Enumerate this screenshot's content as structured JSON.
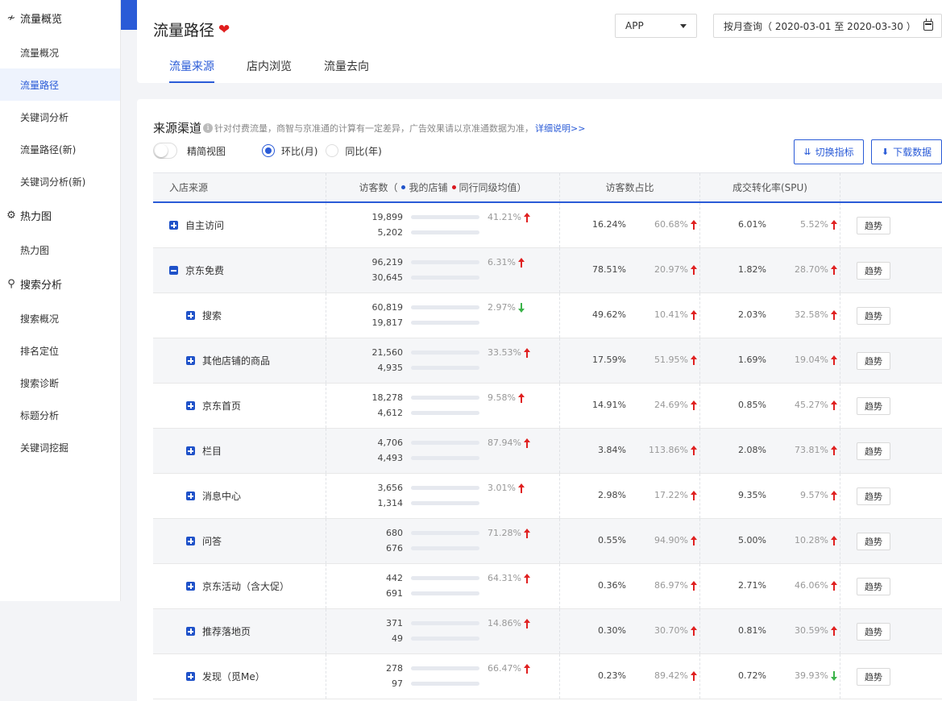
{
  "sidebar": {
    "groups": [
      {
        "icon": "pulse-icon",
        "label": "流量概览",
        "items": [
          "流量概况",
          "流量路径",
          "关键词分析",
          "流量路径(新)",
          "关键词分析(新)"
        ]
      },
      {
        "icon": "heatmap-icon",
        "label": "热力图",
        "items": [
          "热力图"
        ]
      },
      {
        "icon": "search-analysis-icon",
        "label": "搜索分析",
        "items": [
          "搜索概况",
          "排名定位",
          "搜索诊断",
          "标题分析",
          "关键词挖掘"
        ]
      }
    ],
    "active_item": "流量路径"
  },
  "header": {
    "title": "流量路径",
    "device_select": "APP",
    "date_range": "按月查询（ 2020-03-01 至 2020-03-30 ）",
    "tabs": [
      "流量来源",
      "店内浏览",
      "流量去向"
    ]
  },
  "section": {
    "title": "来源渠道",
    "note": "针对付费流量，商智与京准通的计算有一定差异，广告效果请以京准通数据为准，",
    "link": "详细说明>>",
    "toggle_label": "精简视图",
    "radio_month": "环比(月)",
    "radio_year": "同比(年)",
    "switch_button": "切换指标",
    "download_button": "下载数据"
  },
  "colors": {
    "accent": "#2a5bd7",
    "my_shop": "#1f52c9",
    "peer": "#d9171f",
    "up": "#e02020",
    "down": "#3bb34a"
  },
  "table": {
    "headers": {
      "source": "入店来源",
      "visitors_prefix": "访客数（",
      "legend_my": "我的店铺",
      "legend_peer": "同行同级均值",
      "visitors_suffix": "）",
      "share": "访客数占比",
      "conversion": "成交转化率(SPU)"
    },
    "trend_label": "趋势",
    "rows": [
      {
        "name": "自主访问",
        "level": 0,
        "expand": "plus",
        "my": "19,899",
        "peer": "5,202",
        "my_ratio": 0.25,
        "peer_ratio": 0.1,
        "chg": "41.21%",
        "chg_dir": "up",
        "share": "16.24%",
        "share_chg": "60.68%",
        "share_dir": "up",
        "conv": "6.01%",
        "conv_chg": "5.52%",
        "conv_dir": "up"
      },
      {
        "name": "京东免费",
        "level": 0,
        "expand": "minus",
        "my": "96,219",
        "peer": "30,645",
        "my_ratio": 1.0,
        "peer_ratio": 0.35,
        "chg": "6.31%",
        "chg_dir": "up",
        "share": "78.51%",
        "share_chg": "20.97%",
        "share_dir": "up",
        "conv": "1.82%",
        "conv_chg": "28.70%",
        "conv_dir": "up"
      },
      {
        "name": "搜索",
        "level": 1,
        "expand": "plus",
        "my": "60,819",
        "peer": "19,817",
        "my_ratio": 0.65,
        "peer_ratio": 0.25,
        "chg": "2.97%",
        "chg_dir": "down",
        "share": "49.62%",
        "share_chg": "10.41%",
        "share_dir": "up",
        "conv": "2.03%",
        "conv_chg": "32.58%",
        "conv_dir": "up"
      },
      {
        "name": "其他店铺的商品",
        "level": 1,
        "expand": "plus",
        "my": "21,560",
        "peer": "4,935",
        "my_ratio": 0.26,
        "peer_ratio": 0.09,
        "chg": "33.53%",
        "chg_dir": "up",
        "share": "17.59%",
        "share_chg": "51.95%",
        "share_dir": "up",
        "conv": "1.69%",
        "conv_chg": "19.04%",
        "conv_dir": "up"
      },
      {
        "name": "京东首页",
        "level": 1,
        "expand": "plus",
        "my": "18,278",
        "peer": "4,612",
        "my_ratio": 0.24,
        "peer_ratio": 0.09,
        "chg": "9.58%",
        "chg_dir": "up",
        "share": "14.91%",
        "share_chg": "24.69%",
        "share_dir": "up",
        "conv": "0.85%",
        "conv_chg": "45.27%",
        "conv_dir": "up"
      },
      {
        "name": "栏目",
        "level": 1,
        "expand": "plus",
        "my": "4,706",
        "peer": "4,493",
        "my_ratio": 0.09,
        "peer_ratio": 0.09,
        "chg": "87.94%",
        "chg_dir": "up",
        "share": "3.84%",
        "share_chg": "113.86%",
        "share_dir": "up",
        "conv": "2.08%",
        "conv_chg": "73.81%",
        "conv_dir": "up"
      },
      {
        "name": "消息中心",
        "level": 1,
        "expand": "plus",
        "my": "3,656",
        "peer": "1,314",
        "my_ratio": 0.07,
        "peer_ratio": 0.05,
        "chg": "3.01%",
        "chg_dir": "up",
        "share": "2.98%",
        "share_chg": "17.22%",
        "share_dir": "up",
        "conv": "9.35%",
        "conv_chg": "9.57%",
        "conv_dir": "up"
      },
      {
        "name": "问答",
        "level": 1,
        "expand": "plus",
        "my": "680",
        "peer": "676",
        "my_ratio": 0.05,
        "peer_ratio": 0.05,
        "chg": "71.28%",
        "chg_dir": "up",
        "share": "0.55%",
        "share_chg": "94.90%",
        "share_dir": "up",
        "conv": "5.00%",
        "conv_chg": "10.28%",
        "conv_dir": "up"
      },
      {
        "name": "京东活动（含大促）",
        "level": 1,
        "expand": "plus",
        "my": "442",
        "peer": "691",
        "my_ratio": 0.02,
        "peer_ratio": 0.04,
        "chg": "64.31%",
        "chg_dir": "up",
        "share": "0.36%",
        "share_chg": "86.97%",
        "share_dir": "up",
        "conv": "2.71%",
        "conv_chg": "46.06%",
        "conv_dir": "up"
      },
      {
        "name": "推荐落地页",
        "level": 1,
        "expand": "plus",
        "my": "371",
        "peer": "49",
        "my_ratio": 0.02,
        "peer_ratio": 0.02,
        "chg": "14.86%",
        "chg_dir": "up",
        "share": "0.30%",
        "share_chg": "30.70%",
        "share_dir": "up",
        "conv": "0.81%",
        "conv_chg": "30.59%",
        "conv_dir": "up"
      },
      {
        "name": "发现（觅Me）",
        "level": 1,
        "expand": "plus",
        "my": "278",
        "peer": "97",
        "my_ratio": 0.02,
        "peer_ratio": 0.02,
        "chg": "66.47%",
        "chg_dir": "up",
        "share": "0.23%",
        "share_chg": "89.42%",
        "share_dir": "up",
        "conv": "0.72%",
        "conv_chg": "39.93%",
        "conv_dir": "down"
      }
    ]
  }
}
